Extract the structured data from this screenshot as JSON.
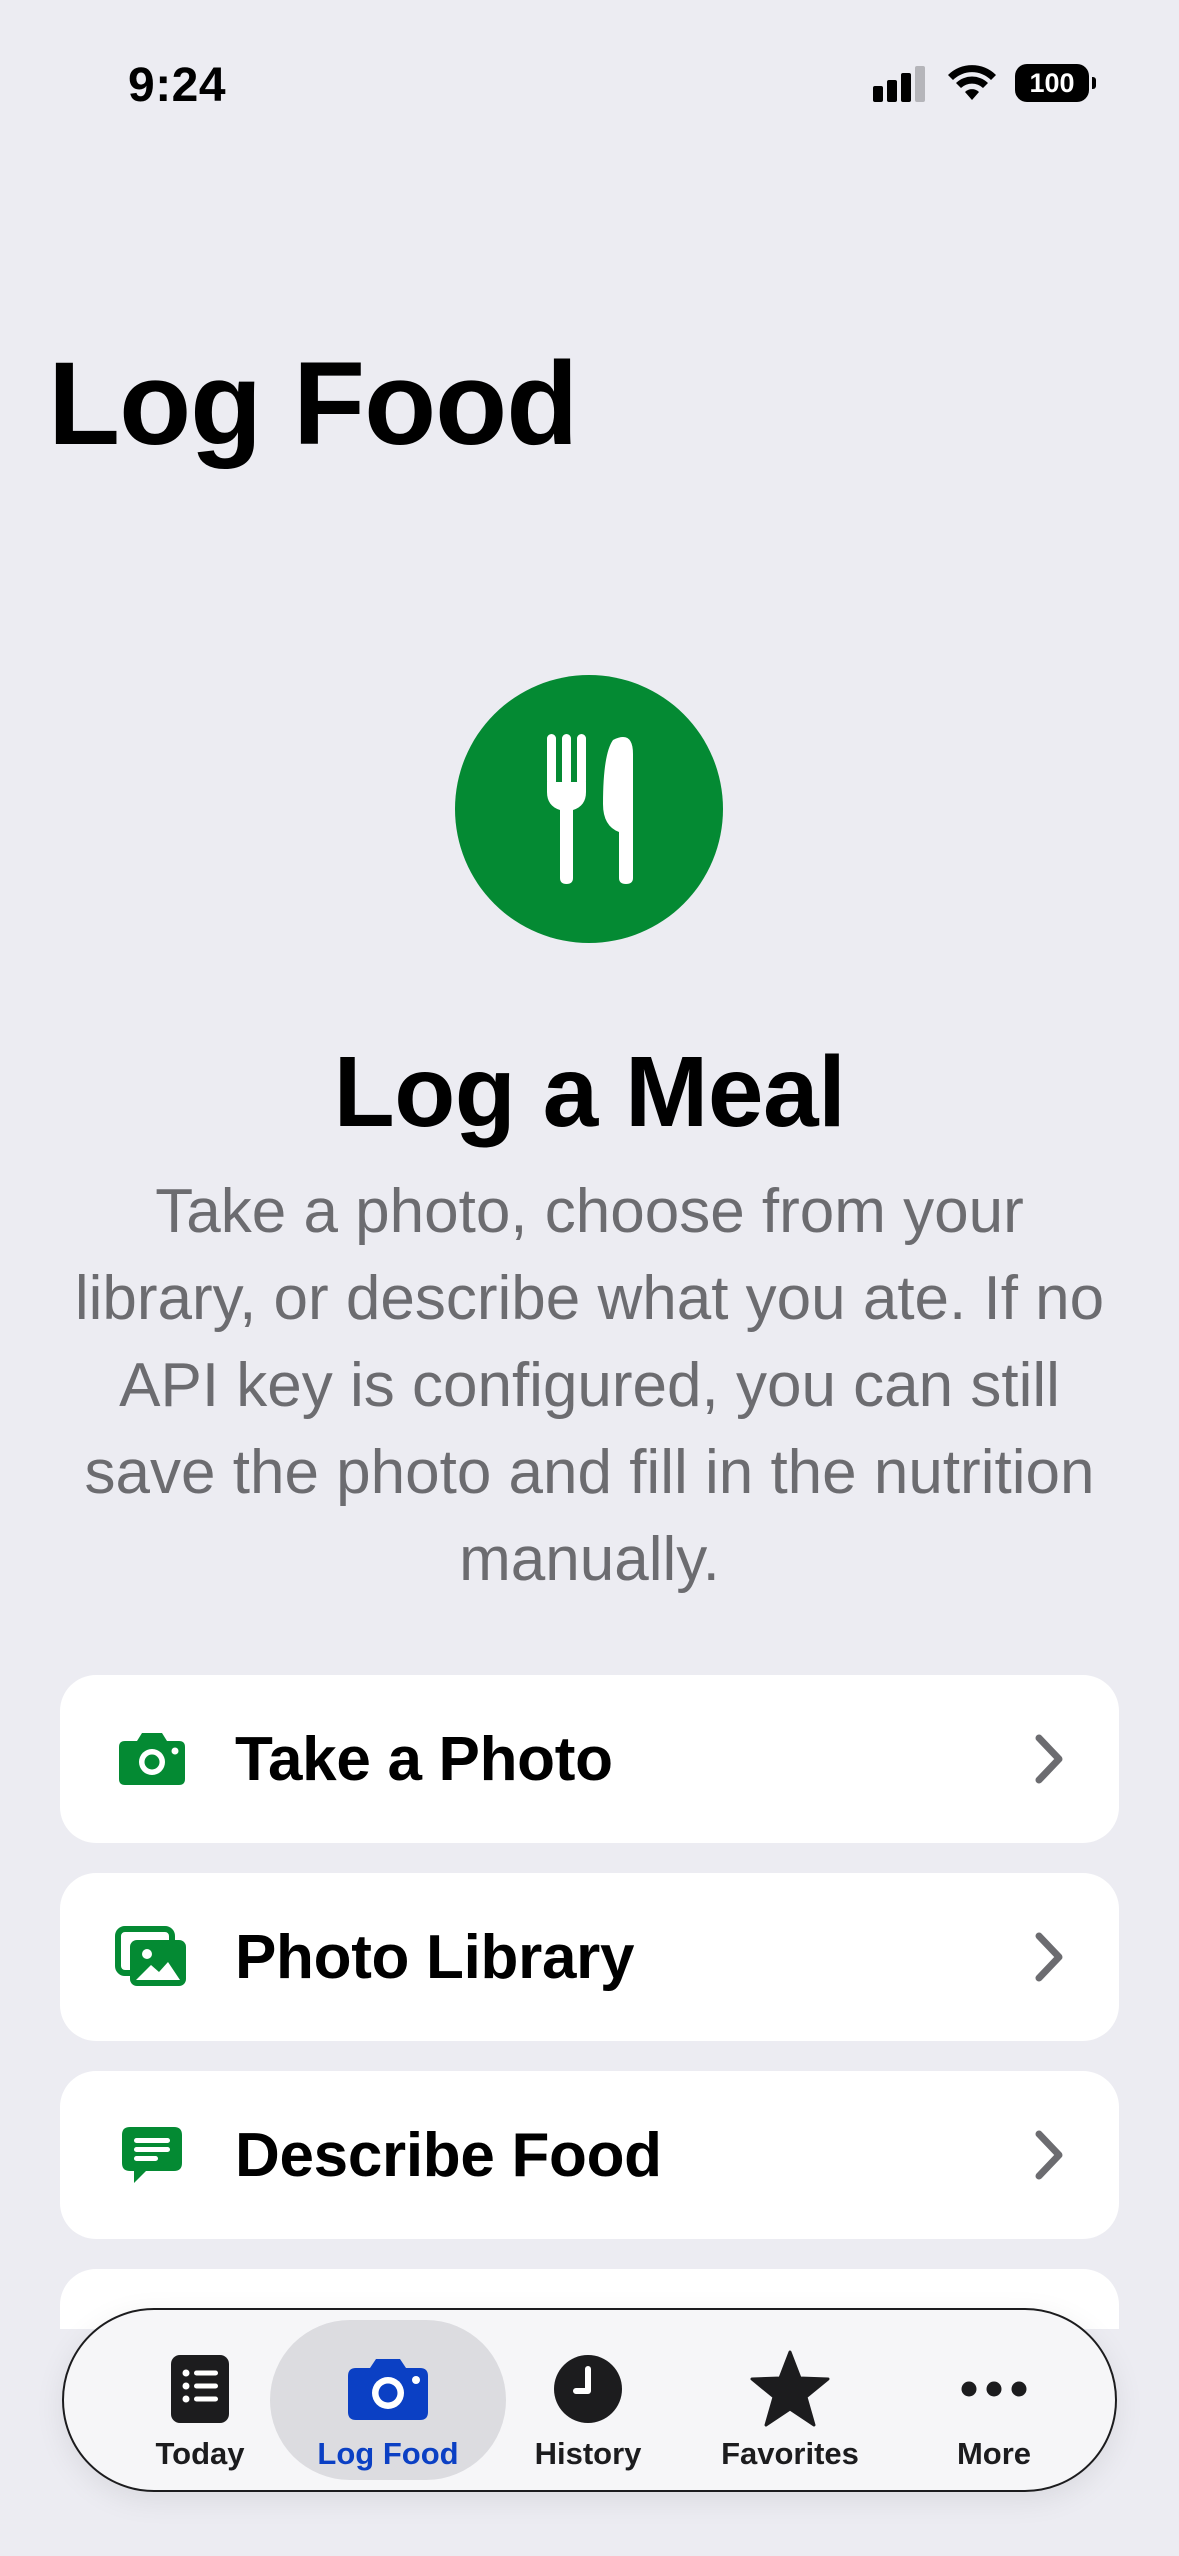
{
  "status_bar": {
    "time": "9:24",
    "battery": "100",
    "icons": [
      "cellular-signal-icon",
      "wifi-icon",
      "battery-icon"
    ]
  },
  "page": {
    "title": "Log Food"
  },
  "hero": {
    "icon": "fork-knife-icon",
    "title": "Log a Meal",
    "description": "Take a photo, choose from your library, or describe what you ate. If no API key is configured, you can still save the photo and fill in the nutrition manually."
  },
  "actions": [
    {
      "label": "Take a Photo",
      "icon": "camera-icon"
    },
    {
      "label": "Photo Library",
      "icon": "photo-library-icon"
    },
    {
      "label": "Describe Food",
      "icon": "message-icon"
    }
  ],
  "tab_bar": {
    "items": [
      {
        "label": "Today",
        "icon": "list-icon"
      },
      {
        "label": "Log Food",
        "icon": "camera-icon",
        "selected": true
      },
      {
        "label": "History",
        "icon": "clock-icon"
      },
      {
        "label": "Favorites",
        "icon": "star-icon"
      },
      {
        "label": "More",
        "icon": "more-icon"
      }
    ]
  },
  "colors": {
    "accent_green": "#048a33",
    "selected_tab": "#0b40c4",
    "background": "#ececf2",
    "secondary_text": "#6c6c70"
  }
}
